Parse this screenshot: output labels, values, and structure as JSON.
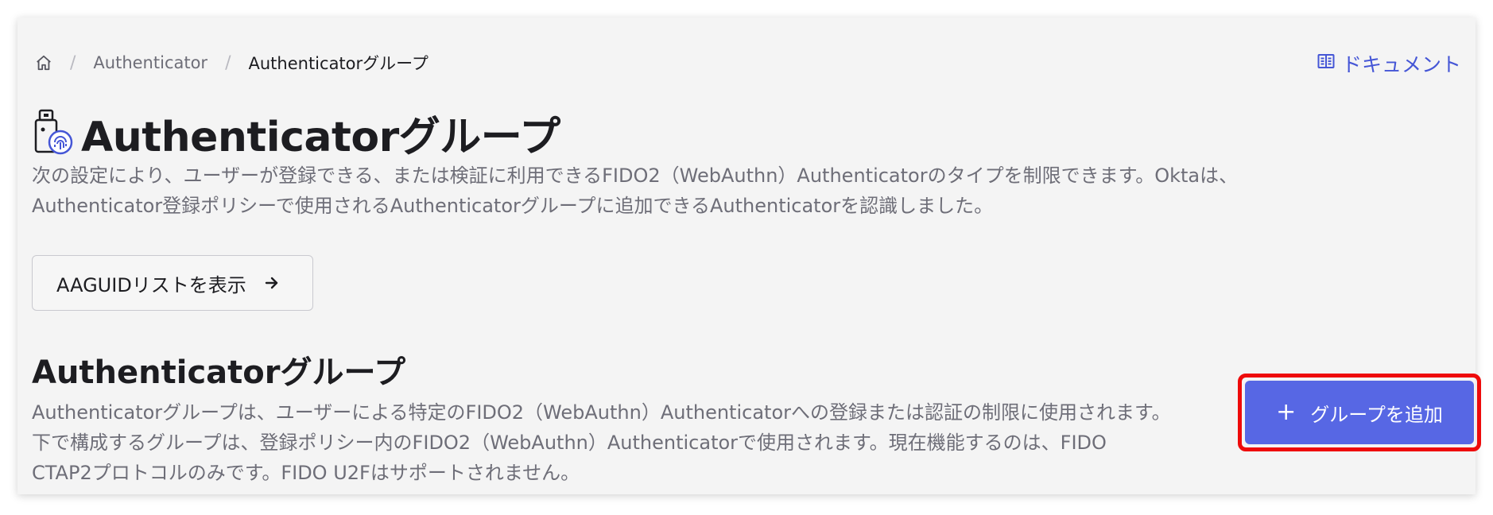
{
  "breadcrumb": {
    "items": [
      "Authenticator",
      "Authenticatorグループ"
    ],
    "separator": "/"
  },
  "header": {
    "docs_link": "ドキュメント"
  },
  "page": {
    "title": "Authenticatorグループ",
    "intro_line1": "次の設定により、ユーザーが登録できる、または検証に利用できるFIDO2（WebAuthn）Authenticatorのタイプを制限できます。Oktaは、",
    "intro_line2": "Authenticator登録ポリシーで使用されるAuthenticatorグループに追加できるAuthenticatorを認識しました。",
    "aaguid_button_label": "AAGUIDリストを表示"
  },
  "section": {
    "title": "Authenticatorグループ",
    "desc_line1": "Authenticatorグループは、ユーザーによる特定のFIDO2（WebAuthn）Authenticatorへの登録または認証の制限に使用されます。",
    "desc_line2": "下で構成するグループは、登録ポリシー内のFIDO2（WebAuthn）Authenticatorで使用されます。現在機能するのは、FIDO",
    "desc_line3": "CTAP2プロトコルのみです。FIDO U2Fはサポートされません。",
    "add_button_label": "グループを追加",
    "add_button_icon": "+"
  },
  "colors": {
    "accent": "#5767e4",
    "link": "#4556d6",
    "highlight": "#ee0a0a",
    "panel_bg": "#f4f4f4"
  },
  "icons": [
    "home-icon",
    "book-icon",
    "authenticator-fingerprint-icon",
    "arrow-right-icon",
    "plus-icon"
  ]
}
